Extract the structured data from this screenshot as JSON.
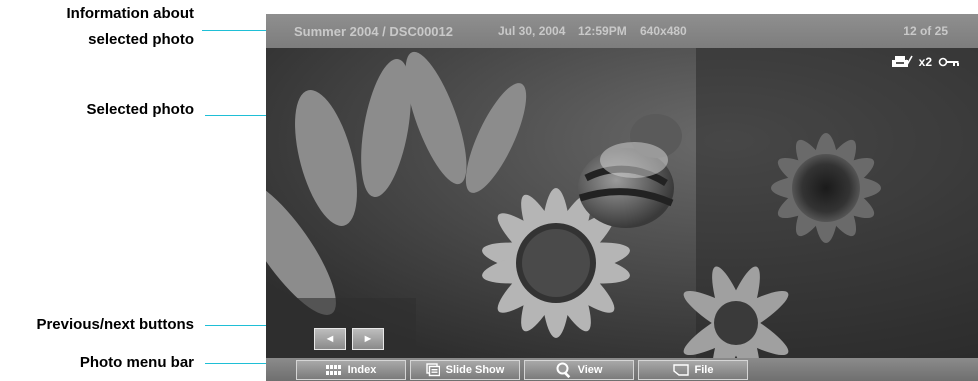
{
  "callouts": {
    "info_line1": "Information about",
    "info_line2": "selected photo",
    "selected_photo": "Selected photo",
    "prev_next": "Previous/next buttons",
    "menu_bar": "Photo menu bar"
  },
  "info_bar": {
    "path": "Summer 2004  /  DSC00012",
    "date": "Jul 30, 2004",
    "time": "12:59PM",
    "resolution": "640x480",
    "position": "12 of 25"
  },
  "status": {
    "print_icon": "printer-check-icon",
    "copies": "x2",
    "protect_icon": "key-icon"
  },
  "nav": {
    "prev_glyph": "◄",
    "next_glyph": "►"
  },
  "menu": {
    "index": "Index",
    "slideshow": "Slide Show",
    "view": "View",
    "file": "File"
  },
  "colors": {
    "leader": "#1fbfd6",
    "info_text": "#c9c9c9"
  }
}
